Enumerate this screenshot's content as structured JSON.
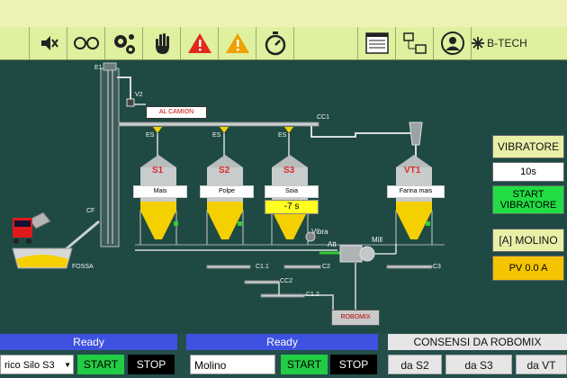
{
  "toolbar": {
    "items": [
      {
        "name": "mute-icon"
      },
      {
        "name": "glasses-icon"
      },
      {
        "name": "gears-icon"
      },
      {
        "name": "hand-icon"
      },
      {
        "name": "alarm-red-icon"
      },
      {
        "name": "warning-icon"
      },
      {
        "name": "stopwatch-icon"
      },
      {
        "name": "report-icon"
      },
      {
        "name": "network-icon"
      },
      {
        "name": "user-icon"
      }
    ],
    "brand": "B-TECH"
  },
  "plant": {
    "labels": {
      "e1": "E1",
      "v2": "V2",
      "cc1": "CC1",
      "cf": "CF",
      "fossa": "FOSSA",
      "es1": "ES",
      "es2": "ES",
      "es3": "ES",
      "c11": "C1.1",
      "cc2": "CC2",
      "c12": "C1.2",
      "c2": "C2",
      "c3": "C3",
      "vibra": "Vibra",
      "att": "Att",
      "mill": "Mill"
    },
    "al_camion": "AL CAMION",
    "robomix": "ROBOMIX",
    "silos": [
      {
        "name": "S1",
        "product": "Mais"
      },
      {
        "name": "S2",
        "product": "Polpe"
      },
      {
        "name": "S3",
        "product": "Soia"
      },
      {
        "name": "VT1",
        "product": "Farina mais"
      }
    ],
    "s3_timer": "-7 s"
  },
  "vibratore": {
    "title": "VIBRATORE",
    "time": "10s",
    "start_label": "START VIBRATORE"
  },
  "molino": {
    "title": "[A] MOLINO",
    "value": "PV 0.0 A"
  },
  "bottom": {
    "left": {
      "status": "Ready",
      "select_value": "rico Silo S3",
      "start": "START",
      "stop": "STOP"
    },
    "middle": {
      "status": "Ready",
      "field_value": "Molino",
      "start": "START",
      "stop": "STOP"
    },
    "consensi": {
      "title": "CONSENSI DA ROBOMIX",
      "buttons": [
        "da S2",
        "da S3",
        "da VT"
      ]
    }
  },
  "colors": {
    "background": "#1f4a44",
    "toolbar": "#dff09e",
    "ready_bar": "#3f51e0",
    "start_green": "#22cc44",
    "silo_fill": "#f5d000",
    "timer_yellow": "#ffff22"
  }
}
